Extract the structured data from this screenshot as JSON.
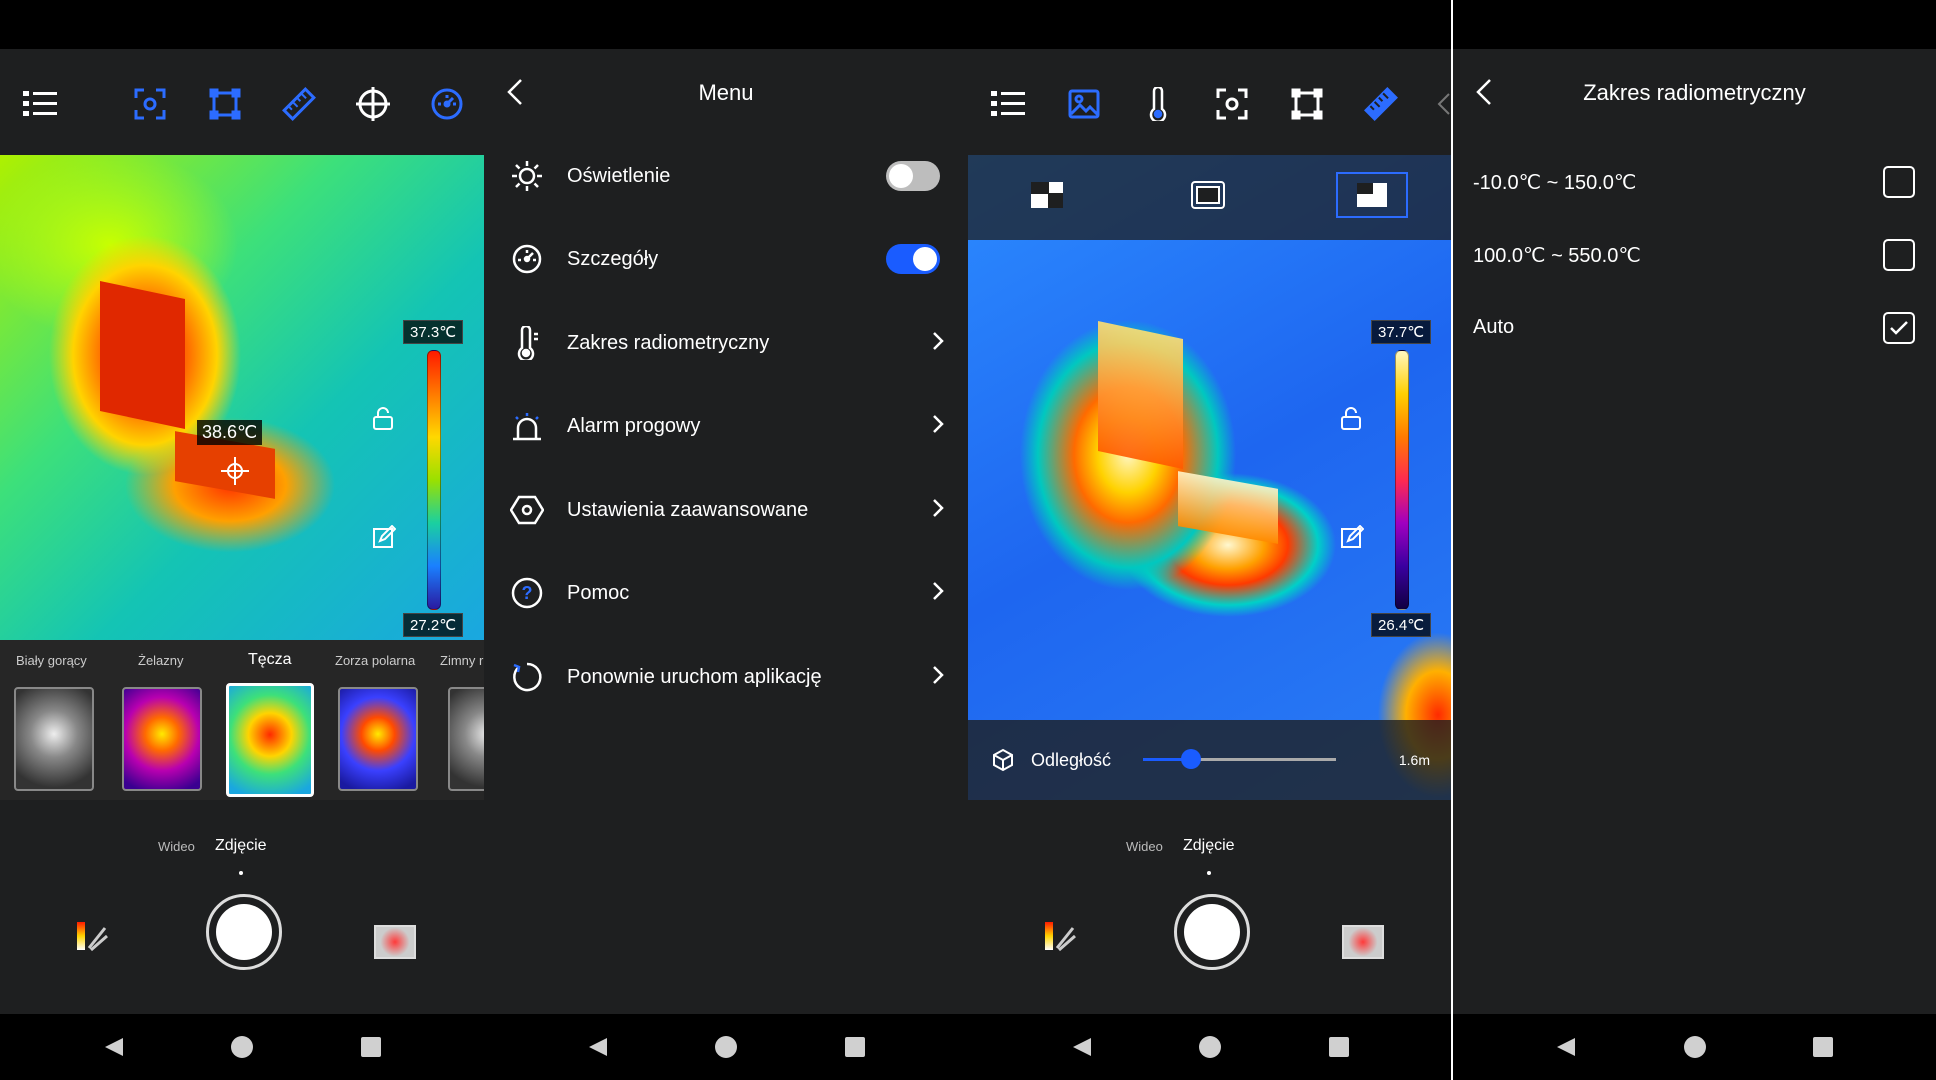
{
  "colors": {
    "accent": "#1a5cff",
    "icon_blue": "#2c6cff"
  },
  "panel1": {
    "toolbar_icons": [
      "list-icon",
      "target-icon",
      "polygon-icon",
      "ruler-icon",
      "crosshair-icon",
      "dashboard-icon"
    ],
    "scale_max": "37.3℃",
    "scale_min": "27.2℃",
    "spot_temp": "38.6℃",
    "palettes": [
      {
        "label": "Biały gorący"
      },
      {
        "label": "Żelazny"
      },
      {
        "label": "Tęcza",
        "selected": true
      },
      {
        "label": "Zorza polarna"
      },
      {
        "label": "Zimny r"
      }
    ],
    "mode_video": "Wideo",
    "mode_photo": "Zdjęcie"
  },
  "panel2": {
    "title": "Menu",
    "items": [
      {
        "label": "Oświetlenie",
        "icon": "sun-icon",
        "control": "toggle",
        "on": false
      },
      {
        "label": "Szczegóły",
        "icon": "gauge-icon",
        "control": "toggle",
        "on": true
      },
      {
        "label": "Zakres radiometryczny",
        "icon": "thermometer-icon",
        "control": "chevron"
      },
      {
        "label": "Alarm progowy",
        "icon": "alarm-icon",
        "control": "chevron"
      },
      {
        "label": "Ustawienia zaawansowane",
        "icon": "hexagon-settings-icon",
        "control": "chevron"
      },
      {
        "label": "Pomoc",
        "icon": "help-icon",
        "control": "chevron"
      },
      {
        "label": "Ponownie uruchom aplikację",
        "icon": "restart-icon",
        "control": "chevron"
      }
    ]
  },
  "panel3": {
    "toolbar_icons": [
      "list-icon",
      "image-icon",
      "thermometer-icon",
      "target-icon",
      "polygon-icon",
      "ruler-icon"
    ],
    "scale_max": "37.7℃",
    "scale_min": "26.4℃",
    "distance_label": "Odległość",
    "distance_value": "1.6m",
    "distance_fraction": 0.25,
    "mode_video": "Wideo",
    "mode_photo": "Zdjęcie"
  },
  "panel4": {
    "title": "Zakres radiometryczny",
    "options": [
      {
        "label": "-10.0℃ ~ 150.0℃",
        "checked": false
      },
      {
        "label": "100.0℃ ~ 550.0℃",
        "checked": false
      },
      {
        "label": "Auto",
        "checked": true
      }
    ]
  }
}
